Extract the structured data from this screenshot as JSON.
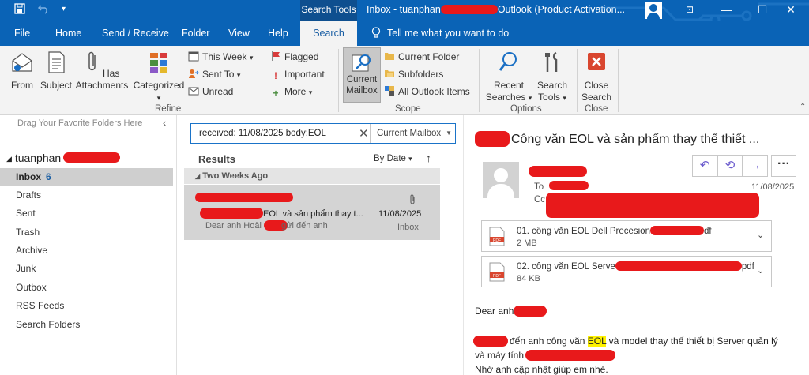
{
  "titlebar": {
    "search_tools": "Search Tools",
    "title_prefix": "Inbox - tuanphan",
    "title_suffix": "Outlook (Product Activation...",
    "restore_icon": "⊡",
    "min_icon": "—",
    "max_icon": "☐",
    "close_icon": "✕"
  },
  "tabs": [
    "File",
    "Home",
    "Send / Receive",
    "Folder",
    "View",
    "Help",
    "Search"
  ],
  "tell_me": "Tell me what you want to do",
  "ribbon": {
    "refine": {
      "from": "From",
      "subject": "Subject",
      "has_attachments": "Has Attachments",
      "categorized": "Categorized",
      "this_week": "This Week",
      "sent_to": "Sent To",
      "unread": "Unread",
      "flagged": "Flagged",
      "important": "Important",
      "more": "More",
      "group_label": "Refine"
    },
    "scope": {
      "current_mailbox": "Current Mailbox",
      "current_folder": "Current Folder",
      "subfolders": "Subfolders",
      "all_outlook_items": "All Outlook Items",
      "group_label": "Scope"
    },
    "options": {
      "recent_searches": "Recent Searches",
      "search_tools": "Search Tools",
      "group_label": "Options"
    },
    "close": {
      "close_search": "Close Search",
      "group_label": "Close"
    }
  },
  "folder_pane": {
    "favorites_hint": "Drag Your Favorite Folders Here",
    "account": "tuanphan",
    "folders": [
      {
        "name": "Inbox",
        "count": "6"
      },
      {
        "name": "Drafts"
      },
      {
        "name": "Sent"
      },
      {
        "name": "Trash"
      },
      {
        "name": "Archive"
      },
      {
        "name": "Junk"
      },
      {
        "name": "Outbox"
      },
      {
        "name": "RSS Feeds"
      },
      {
        "name": "Search Folders"
      }
    ]
  },
  "message_list": {
    "search_query": "received: 11/08/2025 body:EOL",
    "scope": "Current Mailbox",
    "results_label": "Results",
    "sort_label": "By Date",
    "group_header": "Two Weeks Ago",
    "messages": [
      {
        "subject_fragment": "EOL và sản phẩm thay t...",
        "date": "11/08/2025",
        "preview_start": "Dear anh Hoài",
        "preview_end": "gửi đến anh",
        "folder": "Inbox"
      }
    ]
  },
  "reading_pane": {
    "subject": "Công văn EOL và sản phẩm thay thế thiết ...",
    "to_label": "To",
    "cc_label": "Cc",
    "date": "11/08/2025",
    "attachments": [
      {
        "name_start": "01. công văn EOL Dell Precesion",
        "name_end": "df",
        "size": "2 MB"
      },
      {
        "name_start": "02. công văn EOL Serve",
        "name_end": "pdf",
        "size": "84 KB"
      }
    ],
    "body": {
      "greeting": "Dear anh",
      "line1_pre": "đến anh công văn ",
      "line1_hl": "EOL",
      "line1_post": " và model thay thế thiết bị Server quản lý",
      "line2": "và máy tính",
      "line3": "Nhờ anh cập nhật giúp em nhé."
    }
  },
  "colors": {
    "accent": "#0a63b6",
    "ribbon_bg": "#f3f3f3",
    "selected_row": "#d4d4d4",
    "highlight": "#fff200",
    "redaction": "#e8191b"
  }
}
